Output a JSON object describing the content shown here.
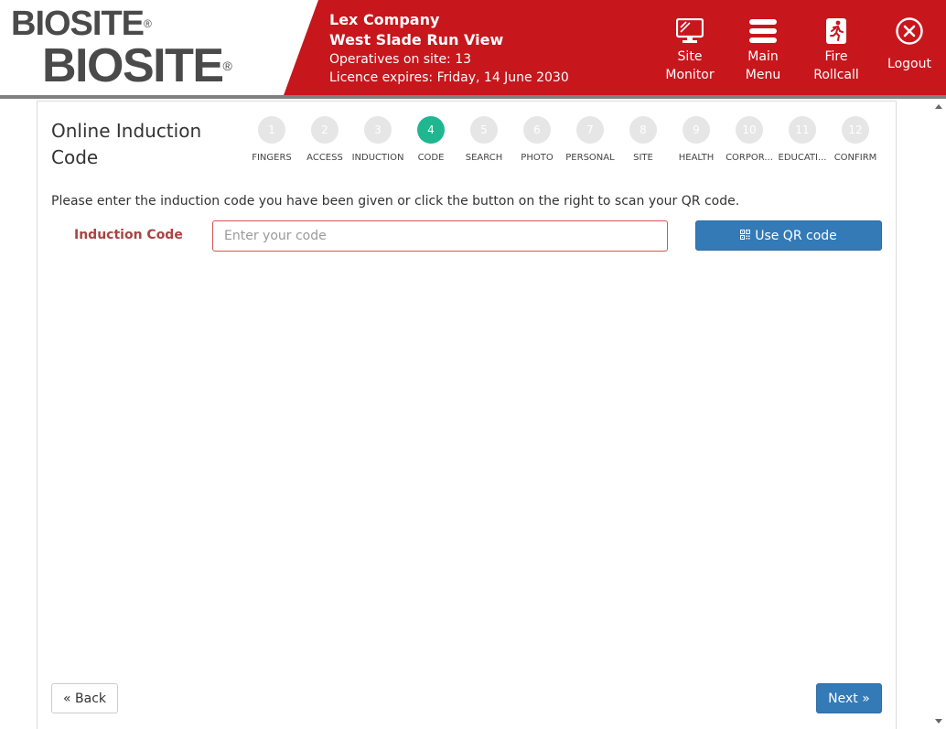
{
  "logo": {
    "small": "BIOSITE",
    "big": "BIOSITE",
    "reg": "®"
  },
  "company": {
    "name": "Lex Company",
    "site": "West Slade Run View",
    "operatives": "Operatives on site: 13",
    "licence": "Licence expires: Friday, 14 June 2030"
  },
  "nav": {
    "site_monitor": {
      "line1": "Site",
      "line2": "Monitor",
      "icon": "monitor-icon"
    },
    "main_menu": {
      "line1": "Main",
      "line2": "Menu",
      "icon": "menu-icon"
    },
    "fire_rollcall": {
      "line1": "Fire",
      "line2": "Rollcall",
      "icon": "fire-exit-icon"
    },
    "logout": {
      "label": "Logout",
      "icon": "close-circle-icon"
    }
  },
  "page": {
    "title": "Online Induction Code",
    "instructions": "Please enter the induction code you have been given or click the button on the right to scan your QR code.",
    "code_label": "Induction Code",
    "code_placeholder": "Enter your code",
    "code_value": "",
    "qr_button": "Use QR code",
    "back_button": "« Back",
    "next_button": "Next »"
  },
  "steps": [
    {
      "num": "1",
      "label": "FINGERS"
    },
    {
      "num": "2",
      "label": "ACCESS"
    },
    {
      "num": "3",
      "label": "INDUCTION"
    },
    {
      "num": "4",
      "label": "CODE"
    },
    {
      "num": "5",
      "label": "SEARCH"
    },
    {
      "num": "6",
      "label": "PHOTO"
    },
    {
      "num": "7",
      "label": "PERSONAL"
    },
    {
      "num": "8",
      "label": "SITE"
    },
    {
      "num": "9",
      "label": "HEALTH"
    },
    {
      "num": "10",
      "label": "CORPOR..."
    },
    {
      "num": "11",
      "label": "EDUCATI..."
    },
    {
      "num": "12",
      "label": "CONFIRM"
    }
  ],
  "active_step": "4",
  "colors": {
    "header_red": "#c8161d",
    "active_step": "#1fb78f",
    "primary_blue": "#337ab7",
    "error_red": "#a94442"
  }
}
